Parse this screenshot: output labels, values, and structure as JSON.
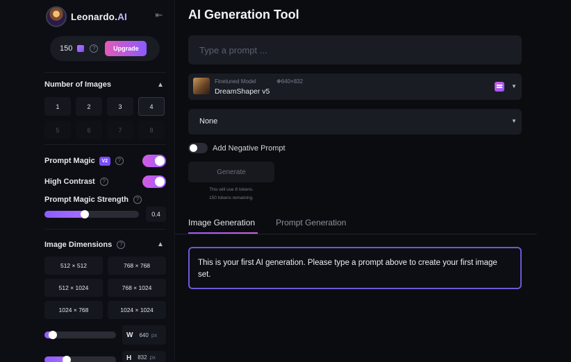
{
  "brand": {
    "name": "Leonardo.",
    "name_suffix": "AI"
  },
  "sidebar": {
    "tokens": {
      "count": "150",
      "upgrade_label": "Upgrade"
    },
    "number_of_images": {
      "title": "Number of Images",
      "options": [
        "1",
        "2",
        "3",
        "4",
        "5",
        "6",
        "7",
        "8"
      ],
      "selected": "4"
    },
    "prompt_magic": {
      "label": "Prompt Magic",
      "badge": "V2",
      "enabled": true
    },
    "high_contrast": {
      "label": "High Contrast",
      "enabled": true
    },
    "prompt_magic_strength": {
      "label": "Prompt Magic Strength",
      "value": "0.4"
    },
    "image_dimensions": {
      "title": "Image Dimensions",
      "options": [
        "512 × 512",
        "768 × 768",
        "512 × 1024",
        "768 × 1024",
        "1024 × 768",
        "1024 × 1024"
      ],
      "width": {
        "letter": "W",
        "value": "640",
        "unit": "px"
      },
      "height": {
        "letter": "H",
        "value": "832",
        "unit": "px"
      }
    }
  },
  "main": {
    "title": "AI Generation Tool",
    "prompt_placeholder": "Type a prompt ...",
    "model": {
      "kind": "Finetuned Model",
      "dims": "640×832",
      "name": "DreamShaper v5"
    },
    "style": {
      "value": "None"
    },
    "negative_prompt_label": "Add Negative Prompt",
    "generate_label": "Generate",
    "token_note_1": "This will use 8 tokens.",
    "token_note_2": "150 tokens remaining.",
    "tabs": [
      "Image Generation",
      "Prompt Generation"
    ],
    "info_text": "This is your first AI generation. Please type a prompt above to create your first image set."
  },
  "colors": {
    "accent_purple": "#8c5bff",
    "accent_pink": "#e35bb7",
    "info_border": "#6f58d8"
  }
}
